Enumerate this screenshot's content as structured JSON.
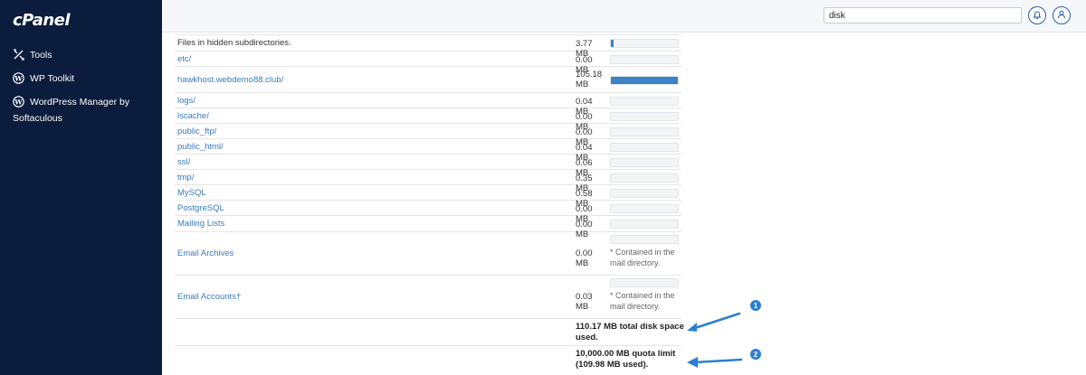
{
  "sidebar": {
    "logo": "cPanel",
    "items": [
      {
        "label": "Tools",
        "icon": "tools-icon"
      },
      {
        "label": "WP Toolkit",
        "icon": "wordpress-icon"
      },
      {
        "label": "WordPress Manager by Softaculous",
        "icon": "wordpress-icon"
      }
    ]
  },
  "header": {
    "search_value": "disk",
    "icons": [
      "bell-icon",
      "user-icon"
    ]
  },
  "table": {
    "rows": [
      {
        "name": "Files in hidden subdirectories.",
        "size": "3.77 MB",
        "fill": 0.034,
        "link": false
      },
      {
        "name": "etc/",
        "size": "0.00 MB",
        "fill": 0,
        "link": true
      },
      {
        "name": "hawkhost.webdemo88.club/",
        "size": "105.18 MB",
        "fill": 1.0,
        "link": true
      },
      {
        "name": "logs/",
        "size": "0.04 MB",
        "fill": 0,
        "link": true
      },
      {
        "name": "lscache/",
        "size": "0.00 MB",
        "fill": 0,
        "link": true
      },
      {
        "name": "public_ftp/",
        "size": "0.00 MB",
        "fill": 0,
        "link": true
      },
      {
        "name": "public_html/",
        "size": "0.04 MB",
        "fill": 0,
        "link": true
      },
      {
        "name": "ssl/",
        "size": "0.06 MB",
        "fill": 0,
        "link": true
      },
      {
        "name": "tmp/",
        "size": "0.35 MB",
        "fill": 0,
        "link": true
      },
      {
        "name": "MySQL",
        "size": "0.58 MB",
        "fill": 0,
        "link": true
      },
      {
        "name": "PostgreSQL",
        "size": "0.00 MB",
        "fill": 0,
        "link": true
      },
      {
        "name": "Mailing Lists",
        "size": "0.00 MB",
        "fill": 0,
        "link": true
      },
      {
        "name": "Email Archives",
        "size": "0.00 MB",
        "fill": 0,
        "link": true,
        "note": "* Contained in the mail directory."
      },
      {
        "name": "Email Accounts†",
        "size": "0.03 MB",
        "fill": 0,
        "link": true,
        "note": "* Contained in the mail directory."
      }
    ],
    "total_used": "110.17 MB total disk space used.",
    "quota": "10,000.00 MB quota limit (109.98 MB used)."
  },
  "annotations": {
    "badge1": "1",
    "badge2": "2",
    "accent_color": "#2d7fd3"
  }
}
